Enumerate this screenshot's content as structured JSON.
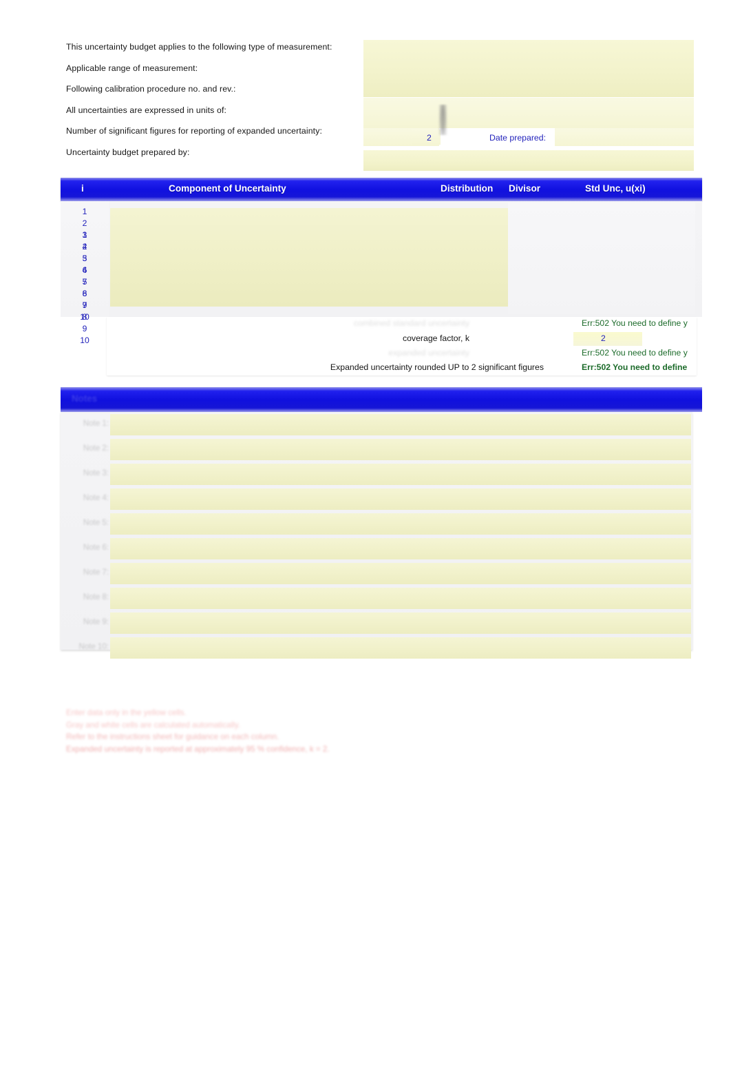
{
  "form": {
    "rows": [
      {
        "label": "This uncertainty budget applies to the following type of measurement:",
        "value": ""
      },
      {
        "label": "Applicable range of measurement:",
        "value": ""
      },
      {
        "label": "Following calibration procedure no. and rev.:",
        "value": ""
      },
      {
        "label": "All uncertainties are expressed in units of:",
        "value": ""
      },
      {
        "label": "Number of significant figures for reporting of expanded uncertainty:",
        "value": "2"
      },
      {
        "label": "Uncertainty budget prepared by:",
        "value": ""
      }
    ],
    "sig_figs_value": "2",
    "date_prepared_label": "Date prepared:",
    "date_prepared_value": ""
  },
  "budget_table": {
    "headers": {
      "index": "i",
      "component": "Component of Uncertainty",
      "blank": "",
      "distribution": "Distribution",
      "divisor": "Divisor",
      "std_unc": "Std Unc, u(xi)"
    },
    "row_indices": [
      "1",
      "2",
      "3",
      "4",
      "5",
      "6",
      "7",
      "8",
      "9",
      "10"
    ],
    "rows": [
      {
        "i": "1",
        "component": "",
        "distribution": "",
        "divisor": "",
        "std_unc": ""
      },
      {
        "i": "2",
        "component": "",
        "distribution": "",
        "divisor": "",
        "std_unc": ""
      },
      {
        "i": "3",
        "component": "",
        "distribution": "",
        "divisor": "",
        "std_unc": ""
      },
      {
        "i": "4",
        "component": "",
        "distribution": "",
        "divisor": "",
        "std_unc": ""
      },
      {
        "i": "5",
        "component": "",
        "distribution": "",
        "divisor": "",
        "std_unc": ""
      },
      {
        "i": "6",
        "component": "",
        "distribution": "",
        "divisor": "",
        "std_unc": ""
      },
      {
        "i": "7",
        "component": "",
        "distribution": "",
        "divisor": "",
        "std_unc": ""
      },
      {
        "i": "8",
        "component": "",
        "distribution": "",
        "divisor": "",
        "std_unc": ""
      },
      {
        "i": "9",
        "component": "",
        "distribution": "",
        "divisor": "",
        "std_unc": ""
      },
      {
        "i": "10",
        "component": "",
        "distribution": "",
        "divisor": "",
        "std_unc": ""
      }
    ]
  },
  "summary": {
    "rows": [
      {
        "label": "combined standard uncertainty",
        "label_legible": false,
        "value": "Err:502 You need to define y",
        "bold": false,
        "has_input": false
      },
      {
        "label": "coverage factor, k",
        "label_legible": true,
        "value": "2",
        "bold": false,
        "has_input": true
      },
      {
        "label": "expanded uncertainty",
        "label_legible": false,
        "value": "Err:502 You need to define y",
        "bold": false,
        "has_input": false
      },
      {
        "label": "Expanded uncertainty rounded UP to 2 significant figures",
        "label_legible": true,
        "value": "Err:502 You need to define",
        "bold": true,
        "has_input": false
      }
    ],
    "error_code": "Err:502",
    "error_text": "You need to define y"
  },
  "notes": {
    "header": "Notes",
    "header_legible": false,
    "rows": [
      {
        "label": "Note 1:",
        "value": ""
      },
      {
        "label": "Note 2:",
        "value": ""
      },
      {
        "label": "Note 3:",
        "value": ""
      },
      {
        "label": "Note 4:",
        "value": ""
      },
      {
        "label": "Note 5:",
        "value": ""
      },
      {
        "label": "Note 6:",
        "value": ""
      },
      {
        "label": "Note 7:",
        "value": ""
      },
      {
        "label": "Note 8:",
        "value": ""
      },
      {
        "label": "Note 9:",
        "value": ""
      },
      {
        "label": "Note 10:",
        "value": ""
      }
    ]
  },
  "footer": {
    "legible": false,
    "lines": [
      "Enter data only in the yellow cells.",
      "Gray and white cells are calculated automatically.",
      "Refer to the instructions sheet for guidance on each column.",
      "Expanded uncertainty is reported at approximately 95 % confidence, k = 2."
    ]
  },
  "colors": {
    "header_blue": "#1111e0",
    "input_yellow": "#f1f1ca",
    "error_green": "#1c6b2a",
    "value_blue": "#2222bb",
    "footer_red": "#e13c3c"
  }
}
